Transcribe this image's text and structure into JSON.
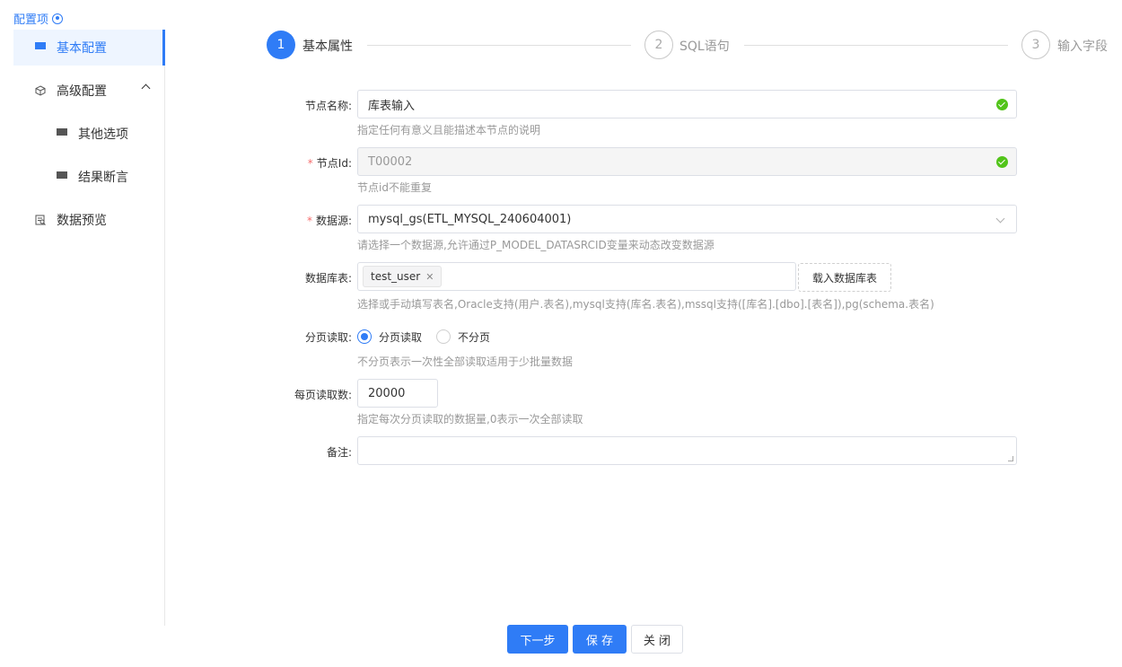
{
  "sidebar": {
    "title": "配置项",
    "items": [
      {
        "label": "基本配置",
        "icon": "grid-icon",
        "active": true
      },
      {
        "label": "高级配置",
        "icon": "cube-icon",
        "expanded": true
      },
      {
        "label": "其他选项",
        "icon": "grid-icon",
        "child": true
      },
      {
        "label": "结果断言",
        "icon": "grid-icon",
        "child": true
      },
      {
        "label": "数据预览",
        "icon": "preview-icon"
      }
    ]
  },
  "steps": [
    {
      "number": "1",
      "label": "基本属性",
      "active": true
    },
    {
      "number": "2",
      "label": "SQL语句",
      "active": false
    },
    {
      "number": "3",
      "label": "输入字段",
      "active": false
    }
  ],
  "form": {
    "node_name": {
      "label": "节点名称:",
      "value": "库表输入",
      "hint": "指定任何有意义且能描述本节点的说明"
    },
    "node_id": {
      "label": "节点Id:",
      "value": "T00002",
      "hint": "节点id不能重复"
    },
    "datasource": {
      "label": "数据源:",
      "value": "mysql_gs(ETL_MYSQL_240604001)",
      "hint": "请选择一个数据源,允许通过P_MODEL_DATASRCID变量来动态改变数据源"
    },
    "table": {
      "label": "数据库表:",
      "tag": "test_user",
      "load_button": "载入数据库表",
      "hint": "选择或手动填写表名,Oracle支持(用户.表名),mysql支持(库名.表名),mssql支持([库名].[dbo].[表名]),pg(schema.表名)"
    },
    "paging": {
      "label": "分页读取:",
      "option_paged": "分页读取",
      "option_unpaged": "不分页",
      "hint": "不分页表示一次性全部读取适用于少批量数据"
    },
    "page_size": {
      "label": "每页读取数:",
      "value": "20000",
      "hint": "指定每次分页读取的数据量,0表示一次全部读取"
    },
    "remark": {
      "label": "备注:",
      "value": ""
    }
  },
  "footer": {
    "next": "下一步",
    "save": "保 存",
    "close": "关 闭"
  },
  "colors": {
    "primary": "#2f7cf6",
    "success": "#52c41a",
    "required": "#f56c6c"
  }
}
